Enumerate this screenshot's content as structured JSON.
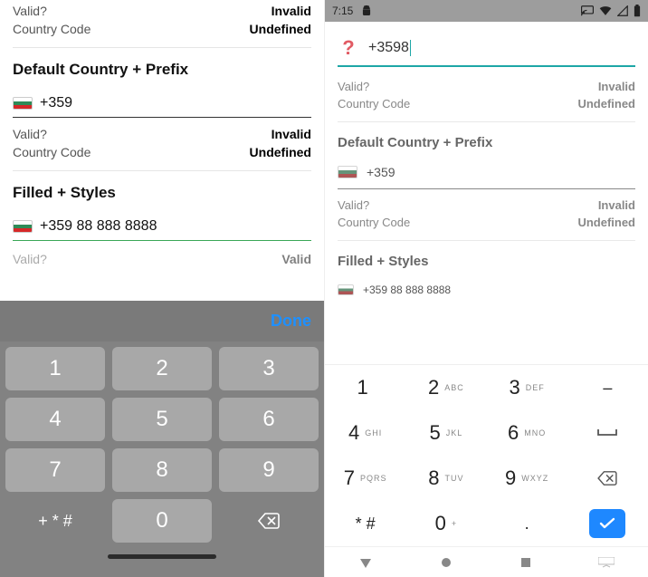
{
  "ios": {
    "sections": {
      "top": {
        "valid_label": "Valid?",
        "valid_value": "Invalid",
        "cc_label": "Country Code",
        "cc_value": "Undefined"
      },
      "default": {
        "title": "Default Country + Prefix",
        "phone": "+359",
        "valid_label": "Valid?",
        "valid_value": "Invalid",
        "cc_label": "Country Code",
        "cc_value": "Undefined"
      },
      "filled": {
        "title": "Filled + Styles",
        "phone": "+359 88 888 8888",
        "valid_label": "Valid?",
        "valid_value": "Valid"
      }
    },
    "keyboard": {
      "done": "Done",
      "keys": [
        [
          "1",
          "2",
          "3"
        ],
        [
          "4",
          "5",
          "6"
        ],
        [
          "7",
          "8",
          "9"
        ],
        [
          "+ * #",
          "0",
          "⌫"
        ]
      ]
    }
  },
  "android": {
    "status": {
      "time": "7:15"
    },
    "input": {
      "value": "+3598"
    },
    "sections": {
      "top": {
        "valid_label": "Valid?",
        "valid_value": "Invalid",
        "cc_label": "Country Code",
        "cc_value": "Undefined"
      },
      "default": {
        "title": "Default Country + Prefix",
        "phone": "+359",
        "valid_label": "Valid?",
        "valid_value": "Invalid",
        "cc_label": "Country Code",
        "cc_value": "Undefined"
      },
      "filled": {
        "title": "Filled + Styles",
        "phone": "+359 88 888 8888"
      }
    },
    "keyboard": {
      "rows": [
        [
          {
            "d": "1",
            "l": ""
          },
          {
            "d": "2",
            "l": "ABC"
          },
          {
            "d": "3",
            "l": "DEF"
          },
          {
            "d": "–",
            "l": ""
          }
        ],
        [
          {
            "d": "4",
            "l": "GHI"
          },
          {
            "d": "5",
            "l": "JKL"
          },
          {
            "d": "6",
            "l": "MNO"
          },
          {
            "d": "␣",
            "l": ""
          }
        ],
        [
          {
            "d": "7",
            "l": "PQRS"
          },
          {
            "d": "8",
            "l": "TUV"
          },
          {
            "d": "9",
            "l": "WXYZ"
          },
          {
            "d": "⌫",
            "l": ""
          }
        ],
        [
          {
            "d": "* #",
            "l": ""
          },
          {
            "d": "0",
            "l": "+"
          },
          {
            "d": ".",
            "l": ""
          },
          {
            "d": "✓",
            "l": ""
          }
        ]
      ]
    }
  }
}
